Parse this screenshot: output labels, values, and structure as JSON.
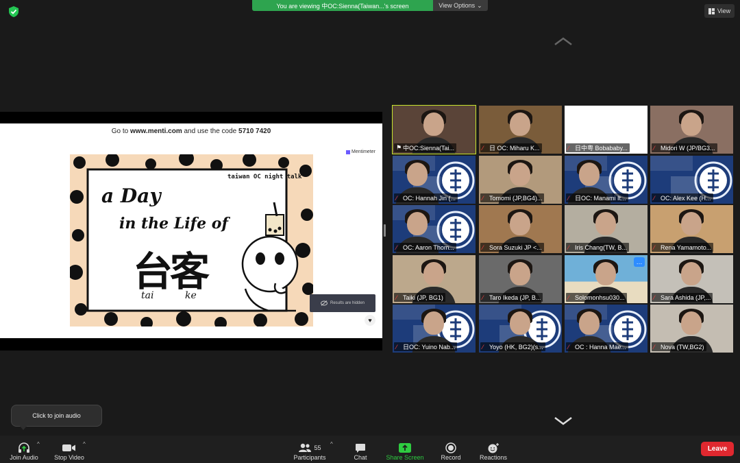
{
  "topbar": {
    "viewing_message": "You are viewing 中OC:Sienna(Taiwan...'s screen",
    "view_options_label": "View Options",
    "view_label": "View"
  },
  "shared_screen": {
    "instruction_prefix": "Go to ",
    "instruction_url": "www.menti.com",
    "instruction_mid": " and use the code ",
    "instruction_code": "5710 7420",
    "brand": "Mentimeter",
    "poster": {
      "tag": "taiwan OC night talk",
      "line1": "a Day",
      "line2": "in the Life of",
      "chars": "台客",
      "roman_left": "tai",
      "roman_right": "ke"
    },
    "results_label": "Results are hidden"
  },
  "participants": [
    {
      "name": "中OC:Sienna(Tai...",
      "active": true,
      "pinned": true,
      "tone": "#5a4438",
      "kind": "person"
    },
    {
      "name": "日 OC: Miharu K...",
      "tone": "#7a5c3a",
      "kind": "person"
    },
    {
      "name": "日中粤 Bobababy...",
      "tone": "#ffffff",
      "kind": "cartoon"
    },
    {
      "name": "Midori W (JP/BG3...",
      "tone": "#8a6f62",
      "kind": "person"
    },
    {
      "name": "OC: Hannah Jin (...",
      "tone": "#1d3c7a",
      "kind": "banner"
    },
    {
      "name": "Tomomi (JP,BG4)...",
      "tone": "#b29a7c",
      "kind": "person"
    },
    {
      "name": "日OC: Manami It...",
      "tone": "#1d3c7a",
      "kind": "banner"
    },
    {
      "name": "OC: Alex Kee (H...",
      "tone": "#1d3c7a",
      "kind": "banner"
    },
    {
      "name": "OC: Aaron Thom...",
      "tone": "#1d3c7a",
      "kind": "banner"
    },
    {
      "name": "Sora Suzuki JP <...",
      "tone": "#a07850",
      "kind": "person"
    },
    {
      "name": "Iris Chang(TW, B...",
      "tone": "#b4aea0",
      "kind": "person"
    },
    {
      "name": "Rena Yamamoto...",
      "tone": "#c8a070",
      "kind": "person"
    },
    {
      "name": "Taiki (JP, BG1)",
      "tone": "#bca88c",
      "kind": "person"
    },
    {
      "name": "Taro Ikeda (JP, B...",
      "tone": "#6a6a6a",
      "kind": "person"
    },
    {
      "name": "Solomonhsu030...",
      "tone": "#6fb0d8",
      "kind": "beach"
    },
    {
      "name": "Sara Ashida (JP,...",
      "tone": "#c4c0b8",
      "kind": "person"
    },
    {
      "name": "日OC: Yuino Nab...",
      "tone": "#1d3c7a",
      "kind": "banner2"
    },
    {
      "name": "Yoyo (HK, BG2)(s...",
      "tone": "#1d3c7a",
      "kind": "banner2"
    },
    {
      "name": "OC : Hanna Mae...",
      "tone": "#1d3c7a",
      "kind": "banner"
    },
    {
      "name": "Nova (TW,BG2)",
      "tone": "#c4bdb2",
      "kind": "person"
    }
  ],
  "tooltip": "Click to join audio",
  "toolbar": {
    "join_audio": "Join Audio",
    "stop_video": "Stop Video",
    "participants": "Participants",
    "participant_count": "55",
    "chat": "Chat",
    "share_screen": "Share Screen",
    "record": "Record",
    "reactions": "Reactions",
    "leave": "Leave"
  },
  "colors": {
    "banner_green": "#2ea44f",
    "active_speaker": "#c8e62e",
    "leave_red": "#e0282f",
    "share_green": "#2ecc40"
  }
}
